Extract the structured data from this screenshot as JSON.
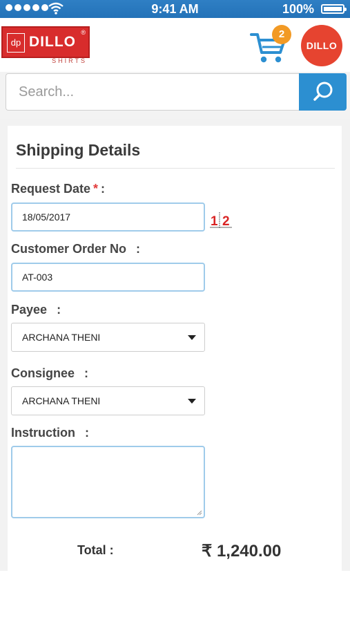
{
  "status_bar": {
    "time": "9:41 AM",
    "battery": "100%"
  },
  "brand": {
    "logo_text": "DILLO",
    "logo_mark": "dp",
    "logo_sub": "SHIRTS",
    "registered": "®",
    "avatar_text": "DILLO"
  },
  "cart": {
    "count": "2",
    "accent": "#f29a25"
  },
  "search": {
    "placeholder": "Search...",
    "button_icon": "search-icon",
    "accent": "#2c8fd1"
  },
  "form": {
    "title": "Shipping Details",
    "request_date": {
      "label": "Request Date",
      "required_mark": "*",
      "colon": ":",
      "value": "18/05/2017",
      "icon": "calendar-icon",
      "icon_text": "1|2"
    },
    "customer_order": {
      "label": "Customer Order No",
      "colon": ":",
      "value": "AT-003"
    },
    "payee": {
      "label": "Payee",
      "colon": ":",
      "value": "ARCHANA THENI"
    },
    "consignee": {
      "label": "Consignee",
      "colon": ":",
      "value": "ARCHANA THENI"
    },
    "instruction": {
      "label": "Instruction",
      "colon": ":",
      "value": ""
    }
  },
  "total": {
    "label": "Total :",
    "value": "₹ 1,240.00"
  }
}
